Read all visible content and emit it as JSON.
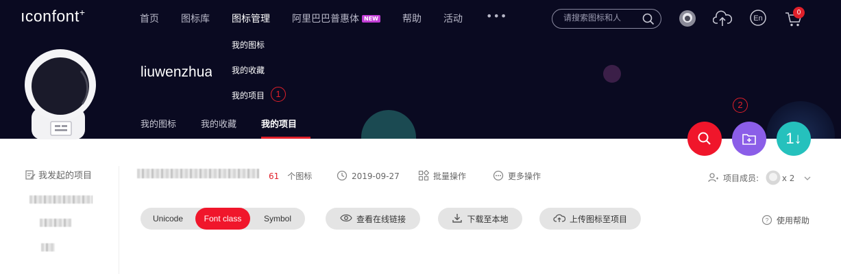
{
  "header": {
    "logo": "ıconfont",
    "logo_plus": "+",
    "nav": [
      "首页",
      "图标库",
      "图标管理",
      "阿里巴巴普惠体",
      "帮助",
      "活动"
    ],
    "nav_new_badge": "NEW",
    "nav_more": "•••",
    "search_placeholder": "请搜索图标和人",
    "lang_label": "En",
    "cart_count": "0"
  },
  "dropdown": {
    "items": [
      "我的图标",
      "我的收藏",
      "我的项目"
    ],
    "annotation_1": "1"
  },
  "profile": {
    "username": "liuwenzhuang"
  },
  "subnav": {
    "items": [
      "我的图标",
      "我的收藏",
      "我的项目"
    ],
    "active_index": 2
  },
  "actions": {
    "annotation_2": "2",
    "sort_glyph": "1↓"
  },
  "sidebar": {
    "title": "我发起的项目"
  },
  "project": {
    "count_num": "61",
    "count_label": "个图标",
    "date": "2019-09-27",
    "batch": "批量操作",
    "more": "更多操作",
    "members_label": "项目成员:",
    "members_count": "x 2"
  },
  "toolbar": {
    "tabs": [
      "Unicode",
      "Font class",
      "Symbol"
    ],
    "active_tab": 1,
    "view_link": "查看在线链接",
    "download": "下载至本地",
    "upload": "上传图标至项目",
    "help": "使用帮助"
  },
  "colors": {
    "banner": "#0a0a21",
    "brand_red": "#f0162b",
    "purple": "#8b5ee8",
    "teal": "#25c1bd"
  }
}
